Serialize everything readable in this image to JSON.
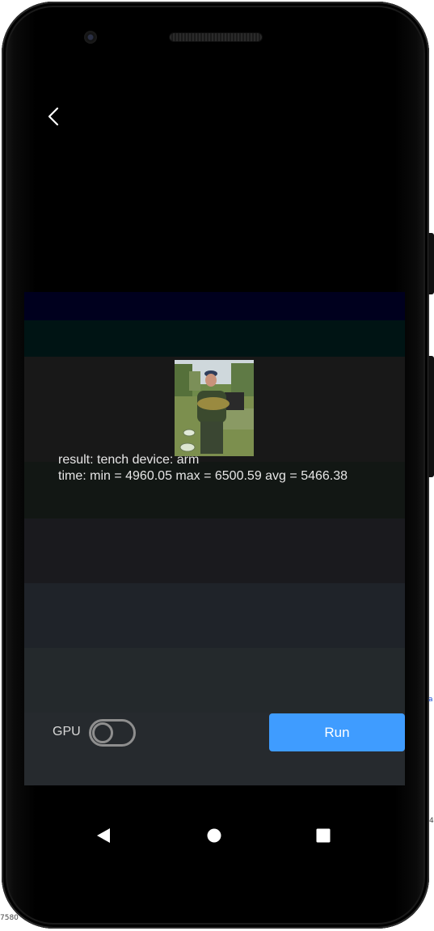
{
  "result": {
    "line1": "result: tench  device: arm",
    "line2": "time: min = 4960.05  max = 6500.59  avg = 5466.38"
  },
  "controls": {
    "gpu_label": "GPU",
    "gpu_enabled": false,
    "run_label": "Run"
  },
  "nav": {
    "icons": [
      "back-triangle-icon",
      "home-circle-icon",
      "recents-square-icon"
    ]
  },
  "colors": {
    "run_button": "#3f9cff",
    "toggle_outline": "#8e8e8e",
    "text": "#e6e6e6"
  },
  "edge": {
    "bottom_left": "7580",
    "right_a": "a",
    "right_4": "4"
  }
}
